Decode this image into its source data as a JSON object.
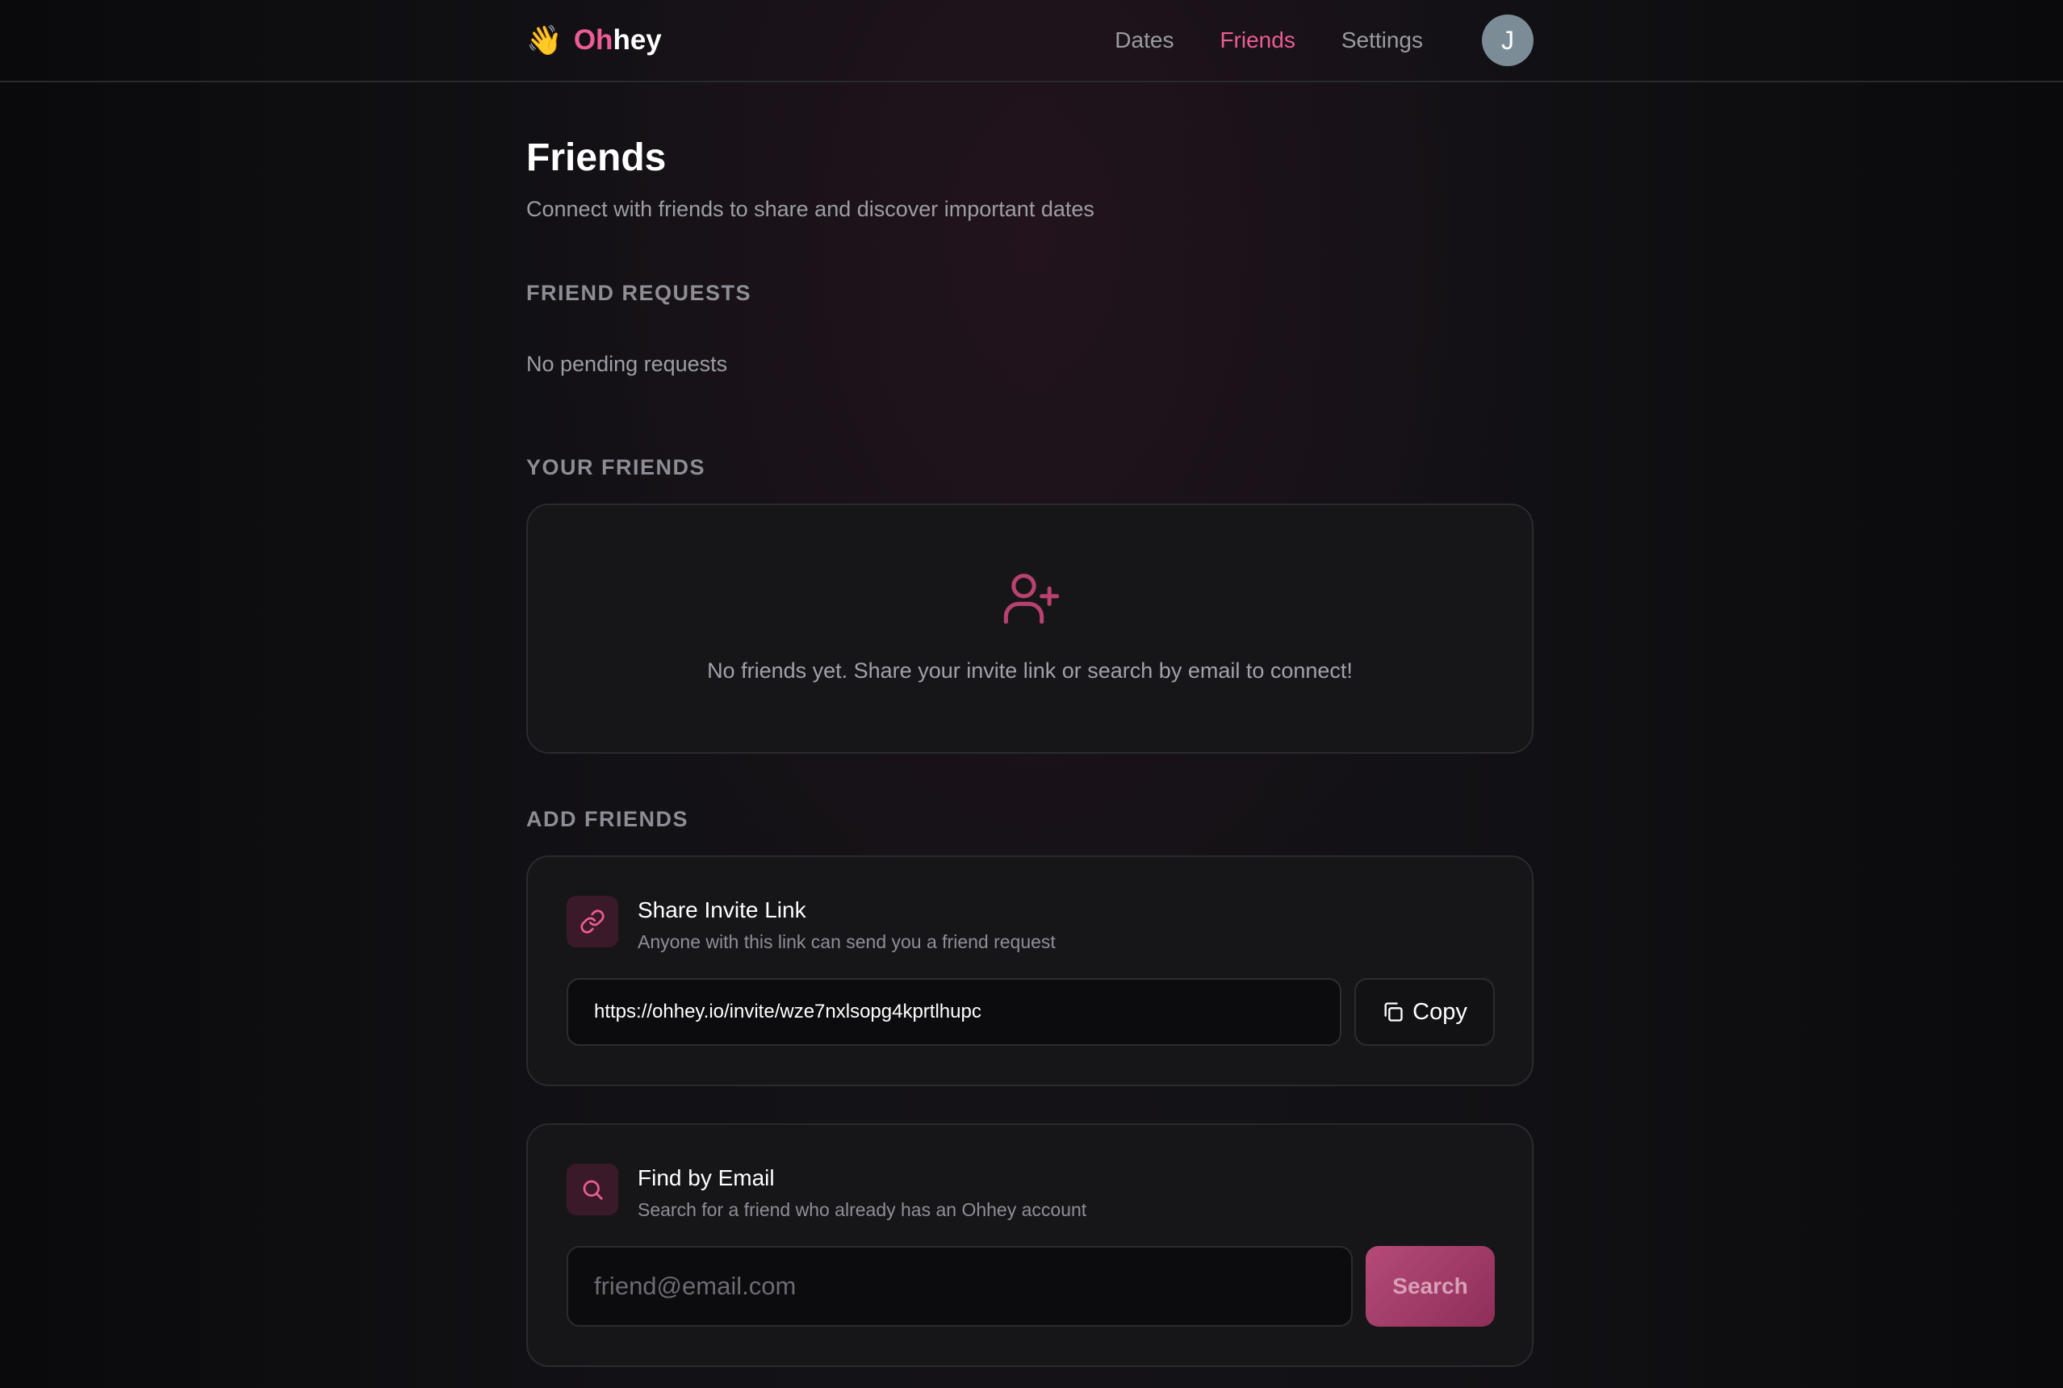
{
  "header": {
    "logo_emoji": "👋",
    "logo_oh": "Oh",
    "logo_hey": "hey",
    "nav": [
      {
        "label": "Dates",
        "active": false
      },
      {
        "label": "Friends",
        "active": true
      },
      {
        "label": "Settings",
        "active": false
      }
    ],
    "avatar_initial": "J"
  },
  "page": {
    "title": "Friends",
    "subtitle": "Connect with friends to share and discover important dates"
  },
  "requests": {
    "label": "FRIEND REQUESTS",
    "empty_text": "No pending requests"
  },
  "friends": {
    "label": "YOUR FRIENDS",
    "empty_icon": "user-plus-icon",
    "empty_text": "No friends yet. Share your invite link or search by email to connect!"
  },
  "add": {
    "label": "ADD FRIENDS",
    "invite": {
      "icon": "link-icon",
      "title": "Share Invite Link",
      "description": "Anyone with this link can send you a friend request",
      "url": "https://ohhey.io/invite/wze7nxlsopg4kprtlhupc",
      "copy_label": "Copy",
      "copy_icon": "copy-icon"
    },
    "find": {
      "icon": "search-icon",
      "title": "Find by Email",
      "description": "Search for a friend who already has an Ohhey account",
      "placeholder": "friend@email.com",
      "value": "",
      "button_label": "Search"
    }
  },
  "colors": {
    "accent": "#ec5c96",
    "background": "#0b0b0d",
    "card": "#161619",
    "avatar": "#7b8c97"
  }
}
